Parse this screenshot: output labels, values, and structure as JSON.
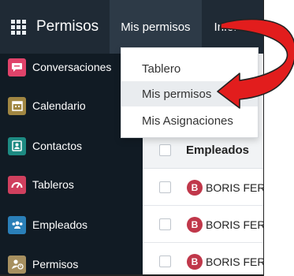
{
  "navbar": {
    "brand": "Permisos",
    "menu_active": "Mis permisos",
    "menu_next": "Infor"
  },
  "sidebar": {
    "items": [
      {
        "label": "Conversaciones",
        "icon": "chat-icon",
        "color": "#e0436a"
      },
      {
        "label": "Calendario",
        "icon": "calendar-icon",
        "color": "#a08642"
      },
      {
        "label": "Contactos",
        "icon": "contacts-icon",
        "color": "#1d8a82"
      },
      {
        "label": "Tableros",
        "icon": "dashboard-icon",
        "color": "#d0405e"
      },
      {
        "label": "Empleados",
        "icon": "employees-icon",
        "color": "#2a7fb8"
      },
      {
        "label": "Permisos",
        "icon": "time-off-icon",
        "color": "#a79060"
      }
    ]
  },
  "dropdown": {
    "items": [
      "Tablero",
      "Mis permisos",
      "Mis Asignaciones"
    ],
    "active_index": 1
  },
  "content": {
    "behind_text": "s",
    "column_header": "Empleados",
    "rows": [
      {
        "avatar": "B",
        "name": "BORIS FER"
      },
      {
        "avatar": "B",
        "name": "BORIS FER"
      },
      {
        "avatar": "B",
        "name": "BORIS FER"
      }
    ]
  },
  "colors": {
    "navbar": "#1f2a35",
    "sidebar": "#111b24",
    "annotation_arrow": "#e21d1d",
    "avatar": "#c0374a"
  }
}
